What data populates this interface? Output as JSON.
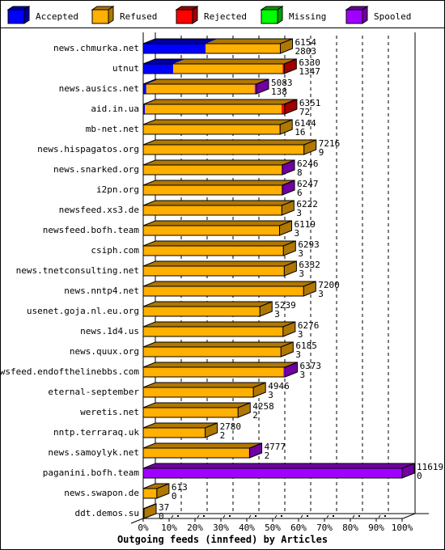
{
  "chart_data": {
    "type": "bar",
    "orientation": "horizontal",
    "stacked": true,
    "style": "3d",
    "title": "Outgoing feeds (innfeed) by Articles",
    "xlabel": "Outgoing feeds (innfeed) by Articles",
    "ylabel": "",
    "xlim": [
      0,
      100
    ],
    "x_unit": "%",
    "x_ticks": [
      "0%",
      "10%",
      "20%",
      "30%",
      "40%",
      "50%",
      "60%",
      "70%",
      "80%",
      "90%",
      "100%"
    ],
    "grid": true,
    "legend_position": "top",
    "legend": [
      {
        "name": "Accepted",
        "color": "#0000ff",
        "dark": "#0000a0"
      },
      {
        "name": "Refused",
        "color": "#ffb000",
        "dark": "#b07800"
      },
      {
        "name": "Rejected",
        "color": "#ff0000",
        "dark": "#a00000"
      },
      {
        "name": "Missing",
        "color": "#00ff00",
        "dark": "#00a000"
      },
      {
        "name": "Spooled",
        "color": "#a000ff",
        "dark": "#7000a0"
      }
    ],
    "max_total": 11619,
    "categories": [
      "news.chmurka.net",
      "utnut",
      "news.ausics.net",
      "aid.in.ua",
      "mb-net.net",
      "news.hispagatos.org",
      "news.snarked.org",
      "i2pn.org",
      "newsfeed.xs3.de",
      "newsfeed.bofh.team",
      "csiph.com",
      "news.tnetconsulting.net",
      "news.nntp4.net",
      "usenet.goja.nl.eu.org",
      "news.1d4.us",
      "news.quux.org",
      "newsfeed.endofthelinebbs.com",
      "eternal-september",
      "weretis.net",
      "nntp.terraraq.uk",
      "news.samoylyk.net",
      "paganini.bofh.team",
      "news.swapon.de",
      "ddt.demos.su"
    ],
    "totals": [
      6154,
      6330,
      5083,
      6351,
      6144,
      7216,
      6246,
      6247,
      6222,
      6119,
      6293,
      6332,
      7200,
      5239,
      6276,
      6185,
      6373,
      4946,
      4258,
      2780,
      4777,
      11619,
      613,
      37
    ],
    "accepted": [
      2803,
      1347,
      138,
      72,
      16,
      9,
      8,
      6,
      3,
      3,
      3,
      3,
      3,
      3,
      3,
      3,
      3,
      3,
      2,
      2,
      2,
      0,
      0,
      0
    ],
    "series": [
      {
        "name": "Accepted",
        "values": [
          2803,
          1347,
          138,
          72,
          16,
          9,
          8,
          6,
          3,
          3,
          3,
          3,
          3,
          3,
          3,
          3,
          3,
          3,
          2,
          2,
          2,
          0,
          0,
          0
        ]
      },
      {
        "name": "Refused",
        "values": [
          3351,
          4913,
          4865,
          6139,
          6128,
          7207,
          6208,
          6211,
          6219,
          6116,
          6290,
          6329,
          7197,
          5236,
          6273,
          6182,
          6288,
          4943,
          4256,
          2778,
          4745,
          0,
          613,
          37
        ]
      },
      {
        "name": "Rejected",
        "values": [
          0,
          70,
          0,
          140,
          0,
          0,
          0,
          0,
          0,
          0,
          0,
          0,
          0,
          0,
          0,
          0,
          0,
          0,
          0,
          0,
          0,
          0,
          0,
          0
        ]
      },
      {
        "name": "Missing",
        "values": [
          0,
          0,
          0,
          0,
          0,
          0,
          0,
          0,
          0,
          0,
          0,
          0,
          0,
          0,
          0,
          0,
          0,
          0,
          0,
          0,
          0,
          0,
          0,
          0
        ]
      },
      {
        "name": "Spooled",
        "values": [
          0,
          0,
          80,
          0,
          0,
          0,
          30,
          30,
          0,
          0,
          0,
          0,
          0,
          0,
          0,
          0,
          82,
          0,
          0,
          0,
          30,
          11619,
          0,
          0
        ]
      }
    ]
  }
}
